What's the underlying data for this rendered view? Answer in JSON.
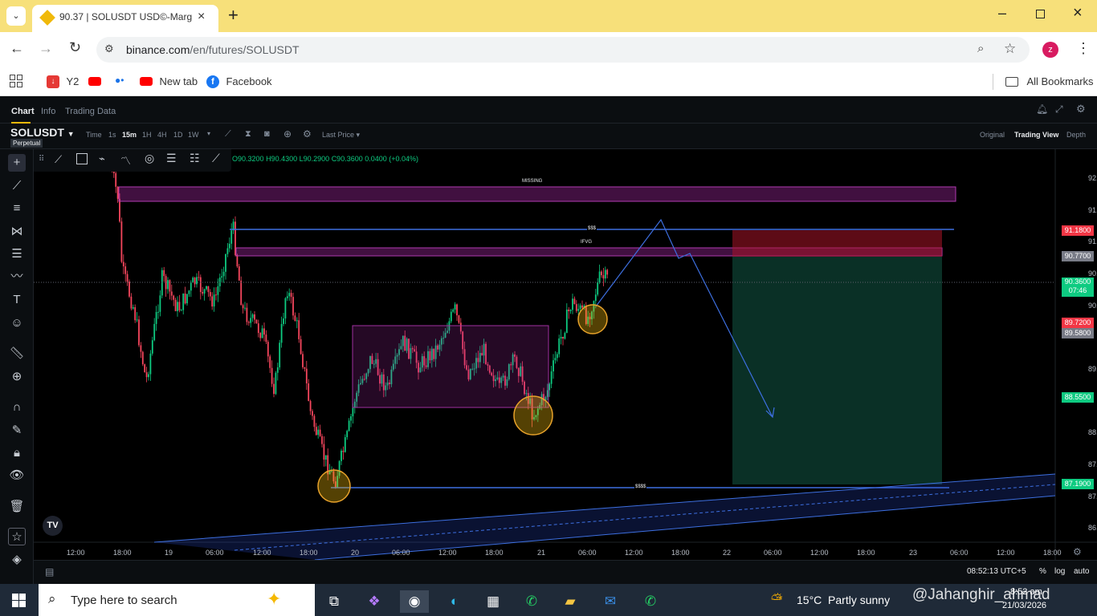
{
  "browser": {
    "tab_title": "90.37 | SOLUSDT USD©-Margin",
    "url_host": "binance.com",
    "url_path": "/en/futures/SOLUSDT",
    "profile_initial": "z",
    "bookmarks": [
      "Y2",
      "New tab",
      "Facebook"
    ],
    "all_bookmarks": "All Bookmarks"
  },
  "header": {
    "tabs": [
      "Chart",
      "Info",
      "Trading Data"
    ],
    "symbol": "SOLUSDT",
    "contract": "Perpetual",
    "intervals": [
      "Time",
      "1s",
      "15m",
      "1H",
      "4H",
      "1D",
      "1W"
    ],
    "active_interval": "15m",
    "price_type": "Last Price",
    "views": [
      "Original",
      "Trading View",
      "Depth"
    ],
    "active_view": "Trading View"
  },
  "ohlc": {
    "o": "O90.3200",
    "h": "H90.4300",
    "l": "L90.2900",
    "c": "C90.3600",
    "chg": "0.0400 (+0.04%)"
  },
  "chart_labels": {
    "missing": "MISSING",
    "sss": "$$$",
    "ifvg": "IFVG",
    "ssss": "$$$$"
  },
  "y_axis": [
    "92.0000",
    "91.5000",
    "91.0000",
    "90.5000",
    "90.0000",
    "89.0000",
    "88.0000",
    "87.5000",
    "87.0000",
    "86.5000"
  ],
  "price_labels": {
    "p1": "91.1800",
    "p2": "90.7700",
    "p3": "90.3600",
    "countdown": "07:46",
    "p4": "89.7200",
    "p5": "89.5800",
    "p6": "88.5500",
    "p7": "87.1900"
  },
  "colors": {
    "p1": "#f23645",
    "p2": "#787b86",
    "p3": "#0ecb81",
    "p4": "#f23645",
    "p5": "#787b86",
    "p6": "#0ecb81",
    "p7": "#0ecb81"
  },
  "x_axis": [
    "12:00",
    "18:00",
    "19",
    "06:00",
    "12:00",
    "18:00",
    "20",
    "06:00",
    "12:00",
    "18:00",
    "21",
    "06:00",
    "12:00",
    "18:00",
    "22",
    "06:00",
    "12:00",
    "18:00",
    "23",
    "06:00",
    "12:00",
    "18:00"
  ],
  "bottom": {
    "clock": "08:52:13 UTC+5",
    "pct": "%",
    "log": "log",
    "auto": "auto"
  },
  "taskbar": {
    "search_placeholder": "Type here to search",
    "weather": "15°C  Partly sunny",
    "time": "8:52 am",
    "date": "21/03/2026",
    "watermark": "@Jahanghir_ahmad"
  }
}
